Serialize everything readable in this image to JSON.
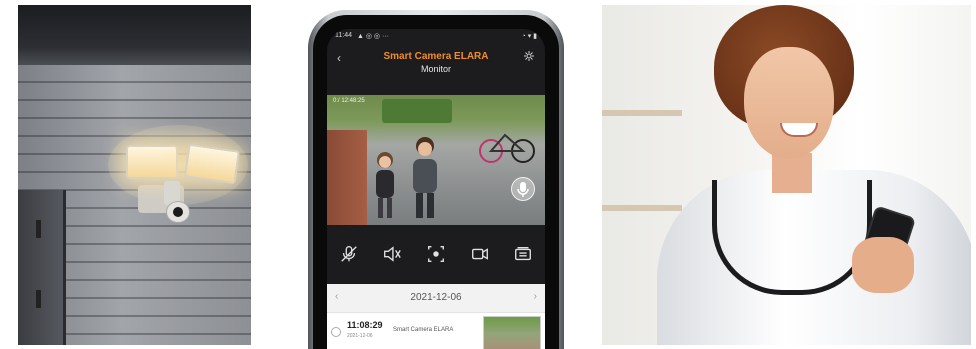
{
  "phone": {
    "status_time": "11:44",
    "status_icons": "▲ ◎ ◎ ···",
    "status_right": "◔ ▾ ▮",
    "header": {
      "back_label": "‹",
      "title": "Smart Camera ELARA",
      "subtitle": "Monitor"
    },
    "video": {
      "osd_text": "0:/ 12:48:25"
    },
    "controls": [
      {
        "name": "mute-mic-icon"
      },
      {
        "name": "mute-speaker-icon"
      },
      {
        "name": "snapshot-icon"
      },
      {
        "name": "record-icon"
      },
      {
        "name": "gallery-icon"
      }
    ],
    "date_bar": {
      "prev": "‹",
      "date": "2021-12-06",
      "next": "›"
    },
    "events": [
      {
        "time": "11:08:29",
        "date": "2021-12-06",
        "name": "Smart Camera ELARA"
      }
    ]
  },
  "colors": {
    "accent": "#f28c28",
    "screen_bg": "#1c1c1e"
  }
}
